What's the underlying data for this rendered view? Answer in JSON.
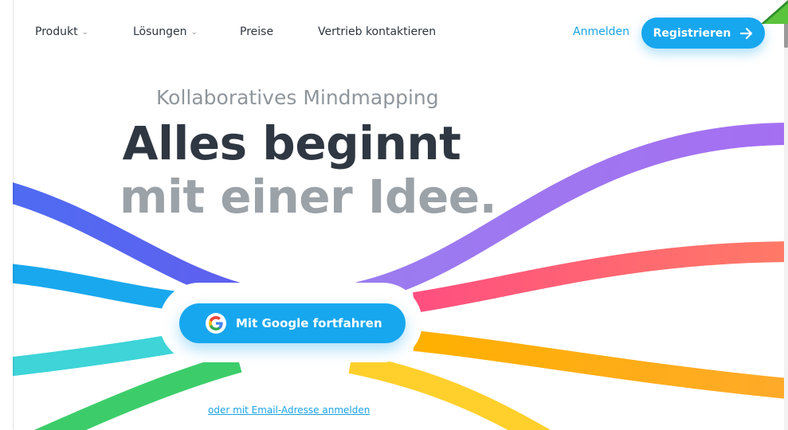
{
  "nav": {
    "items": [
      {
        "label": "Produkt",
        "has_dropdown": true
      },
      {
        "label": "Lösungen",
        "has_dropdown": true
      },
      {
        "label": "Preise",
        "has_dropdown": false
      },
      {
        "label": "Vertrieb kontaktieren",
        "has_dropdown": false
      }
    ],
    "login_label": "Anmelden",
    "register_label": "Registrieren"
  },
  "hero": {
    "subtitle": "Kollaboratives Mindmapping",
    "headline_line1": "Alles beginnt",
    "headline_line2": "mit einer Idee."
  },
  "signup": {
    "google_button_label": "Mit Google fortfahren",
    "email_link_label": "oder mit Email-Adresse anmelden"
  },
  "icons": {
    "dropdown": "chevron-down-icon",
    "register_arrow": "arrow-right-icon",
    "google": "google-logo-icon"
  },
  "colors": {
    "accent": "#17a7ef",
    "heading_dark": "#2f3742",
    "heading_light": "#9ba2a8",
    "ribbons": [
      "#5667f0",
      "#1fa6ef",
      "#3fd3d9",
      "#3dce6a",
      "#9e78f0",
      "#ff5c7a",
      "#ffb020",
      "#ffd030"
    ]
  }
}
